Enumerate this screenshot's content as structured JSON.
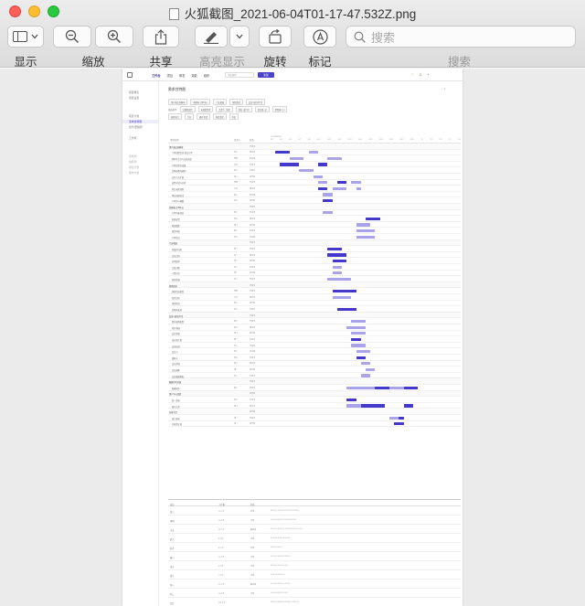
{
  "window": {
    "title": "火狐截图_2021-06-04T01-17-47.532Z.png"
  },
  "toolbar": {
    "display_label": "显示",
    "zoom_label": "缩放",
    "share_label": "共享",
    "highlight_label": "高亮显示",
    "rotate_label": "旋转",
    "markup_label": "标记",
    "search_placeholder": "搜索",
    "search_label": "搜索"
  },
  "colors": {
    "bar_primary": "#4338c9",
    "bar_light": "#a9a3ea",
    "close": "#fe5f57",
    "minimize": "#febc2e",
    "zoom": "#28c840"
  },
  "app": {
    "nav": [
      {
        "label": "工作台",
        "active": true
      },
      {
        "label": "项目",
        "active": false
      },
      {
        "label": "研发",
        "active": false
      },
      {
        "label": "效能",
        "active": false
      },
      {
        "label": "组织",
        "active": false
      }
    ],
    "search_text": "全局搜索",
    "new_button": "新建",
    "sidebar": [
      {
        "label": "项目概览",
        "state": "normal"
      },
      {
        "label": "项目设置",
        "state": "normal"
      },
      {
        "label": "项目计划",
        "state": "normal"
      },
      {
        "label": "需求甘特图",
        "state": "selected"
      },
      {
        "label": "迭代/里程碑",
        "state": "normal"
      },
      {
        "label": "工作项",
        "state": "normal"
      },
      {
        "label": "需求池",
        "state": "gray"
      },
      {
        "label": "缺陷池",
        "state": "gray"
      },
      {
        "label": "测试计划",
        "state": "gray"
      },
      {
        "label": "发布计划",
        "state": "gray"
      }
    ],
    "page_title": "需求甘特图",
    "filters_line1": [
      "用户端交易模块",
      "商家端-订单中心",
      "门店收银",
      "营销活动",
      "会员与积分平台"
    ],
    "filters_line2_label": "筛选条件",
    "filters_line2": [
      "已规划迭代",
      "未规划需求",
      "负责人: 全部",
      "状态: 进行中",
      "优先级: 高",
      "里程碑: Q3"
    ],
    "filters_line3": [
      "按周显示",
      "今日",
      "展开全部",
      "收起全部",
      "导出"
    ],
    "columns": {
      "name": "需求名称",
      "owner": "负责人",
      "status": "状态"
    },
    "month_label": "2021年06月",
    "date_ticks": [
      "6/1",
      "6/3",
      "6/5",
      "6/7",
      "6/9",
      "6/11",
      "6/13",
      "6/15",
      "6/17",
      "6/19",
      "6/21",
      "6/23",
      "6/25",
      "6/27",
      "6/29",
      "7/1",
      "7/3",
      "7/5",
      "7/7",
      "7/9"
    ]
  },
  "gantt": {
    "timeline_days": 40,
    "rows": [
      {
        "name": "用户端交易模块",
        "owner": "",
        "status": "开发中",
        "group": true,
        "bars": []
      },
      {
        "name": "下单流程优化-提交订单",
        "owner": "张三",
        "status": "测试中",
        "group": false,
        "bars": [
          [
            1,
            3,
            "p"
          ],
          [
            8,
            2,
            "l"
          ]
        ]
      },
      {
        "name": "购物车合并与失效商品",
        "owner": "李四",
        "status": "已完成",
        "group": false,
        "bars": [
          [
            4,
            3,
            "l"
          ],
          [
            12,
            3,
            "l"
          ]
        ]
      },
      {
        "name": "订单详情页改版",
        "owner": "王五",
        "status": "开发中",
        "group": false,
        "bars": [
          [
            2,
            4,
            "p"
          ],
          [
            10,
            2,
            "p"
          ]
        ]
      },
      {
        "name": "优惠券叠加规则",
        "owner": "赵六",
        "status": "开发中",
        "group": false,
        "bars": [
          [
            6,
            3,
            "l"
          ]
        ]
      },
      {
        "name": "支付方式扩展",
        "owner": "张三",
        "status": "待开发",
        "group": false,
        "bars": [
          [
            9,
            2,
            "l"
          ]
        ]
      },
      {
        "name": "发票申请与开具",
        "owner": "李四",
        "status": "开发中",
        "group": false,
        "bars": [
          [
            10,
            2,
            "l"
          ],
          [
            14,
            2,
            "p"
          ],
          [
            17,
            2,
            "l"
          ]
        ]
      },
      {
        "name": "售后退款流程",
        "owner": "王五",
        "status": "测试中",
        "group": false,
        "bars": [
          [
            10,
            2,
            "p"
          ],
          [
            13,
            3,
            "l"
          ],
          [
            18,
            1,
            "l"
          ]
        ]
      },
      {
        "name": "地址管理优化",
        "owner": "赵六",
        "status": "已完成",
        "group": false,
        "bars": [
          [
            11,
            2,
            "l"
          ]
        ]
      },
      {
        "name": "订单评价晒图",
        "owner": "孙七",
        "status": "待开发",
        "group": false,
        "bars": [
          [
            11,
            2,
            "p"
          ]
        ]
      },
      {
        "name": "商家端-订单中心",
        "owner": "",
        "status": "开发中",
        "group": true,
        "bars": []
      },
      {
        "name": "订单列表筛选",
        "owner": "周八",
        "status": "开发中",
        "group": false,
        "bars": [
          [
            11,
            2,
            "l"
          ]
        ]
      },
      {
        "name": "批量发货",
        "owner": "吴九",
        "status": "测试中",
        "group": false,
        "bars": [
          [
            20,
            3,
            "p"
          ]
        ]
      },
      {
        "name": "物流跟踪",
        "owner": "郑十",
        "status": "待开发",
        "group": false,
        "bars": [
          [
            18,
            3,
            "l"
          ]
        ]
      },
      {
        "name": "退货审核",
        "owner": "周八",
        "status": "开发中",
        "group": false,
        "bars": [
          [
            18,
            4,
            "l"
          ]
        ]
      },
      {
        "name": "订单导出",
        "owner": "吴九",
        "status": "已完成",
        "group": false,
        "bars": [
          [
            18,
            4,
            "l"
          ]
        ]
      },
      {
        "name": "门店收银",
        "owner": "",
        "status": "开发中",
        "group": true,
        "bars": []
      },
      {
        "name": "收银台扫码",
        "owner": "钱一",
        "status": "开发中",
        "group": false,
        "bars": [
          [
            12,
            3,
            "p"
          ]
        ]
      },
      {
        "name": "会员识别",
        "owner": "孙二",
        "status": "测试中",
        "group": false,
        "bars": [
          [
            12,
            4,
            "p"
          ]
        ]
      },
      {
        "name": "挂单取单",
        "owner": "钱一",
        "status": "待开发",
        "group": false,
        "bars": [
          [
            13,
            3,
            "p"
          ]
        ]
      },
      {
        "name": "交班对账",
        "owner": "孙二",
        "status": "开发中",
        "group": false,
        "bars": [
          [
            13,
            2,
            "l"
          ]
        ]
      },
      {
        "name": "小票打印",
        "owner": "钱一",
        "status": "已完成",
        "group": false,
        "bars": [
          [
            13,
            2,
            "l"
          ]
        ]
      },
      {
        "name": "离线收银",
        "owner": "孙二",
        "status": "开发中",
        "group": false,
        "bars": [
          [
            12,
            5,
            "l"
          ]
        ]
      },
      {
        "name": "营销活动",
        "owner": "",
        "status": "开发中",
        "group": true,
        "bars": []
      },
      {
        "name": "满减活动配置",
        "owner": "李四",
        "status": "开发中",
        "group": false,
        "bars": [
          [
            13,
            5,
            "p"
          ]
        ]
      },
      {
        "name": "秒杀活动",
        "owner": "王五",
        "status": "测试中",
        "group": false,
        "bars": [
          [
            13,
            4,
            "l"
          ]
        ]
      },
      {
        "name": "拼团活动",
        "owner": "赵六",
        "status": "待开发",
        "group": false,
        "bars": []
      },
      {
        "name": "优惠券发放",
        "owner": "孙七",
        "status": "开发中",
        "group": false,
        "bars": [
          [
            14,
            4,
            "p"
          ]
        ]
      },
      {
        "name": "会员与积分平台",
        "owner": "",
        "status": "开发中",
        "group": true,
        "bars": []
      },
      {
        "name": "积分规则配置",
        "owner": "周八",
        "status": "开发中",
        "group": false,
        "bars": [
          [
            17,
            3,
            "l"
          ]
        ]
      },
      {
        "name": "积分商城",
        "owner": "吴九",
        "status": "测试中",
        "group": false,
        "bars": [
          [
            16,
            4,
            "l"
          ]
        ]
      },
      {
        "name": "会员等级",
        "owner": "郑十",
        "status": "待开发",
        "group": false,
        "bars": [
          [
            17,
            3,
            "l"
          ]
        ]
      },
      {
        "name": "成长值计算",
        "owner": "钱一",
        "status": "开发中",
        "group": false,
        "bars": [
          [
            17,
            2,
            "p"
          ]
        ]
      },
      {
        "name": "会员权益",
        "owner": "孙二",
        "status": "开发中",
        "group": false,
        "bars": [
          [
            17,
            3,
            "l"
          ]
        ]
      },
      {
        "name": "会员卡",
        "owner": "周八",
        "status": "已完成",
        "group": false,
        "bars": [
          [
            18,
            3,
            "l"
          ]
        ]
      },
      {
        "name": "储值卡",
        "owner": "吴九",
        "status": "开发中",
        "group": false,
        "bars": [
          [
            18,
            2,
            "p"
          ]
        ]
      },
      {
        "name": "会员营销",
        "owner": "郑十",
        "status": "测试中",
        "group": false,
        "bars": [
          [
            19,
            2,
            "l"
          ]
        ]
      },
      {
        "name": "会员画像",
        "owner": "钱一",
        "status": "待开发",
        "group": false,
        "bars": [
          [
            20,
            2,
            "l"
          ]
        ]
      },
      {
        "name": "会员数据看板",
        "owner": "孙二",
        "status": "开发中",
        "group": false,
        "bars": [
          [
            19,
            2,
            "l"
          ]
        ]
      },
      {
        "name": "数据中台对接",
        "owner": "",
        "status": "开发中",
        "group": true,
        "bars": []
      },
      {
        "name": "数据同步",
        "owner": "周八",
        "status": "开发中",
        "group": false,
        "bars": [
          [
            16,
            15,
            "l"
          ],
          [
            22,
            3,
            "p"
          ],
          [
            28,
            3,
            "p"
          ]
        ]
      },
      {
        "name": "用户中心改造",
        "owner": "",
        "status": "待开发",
        "group": true,
        "bars": []
      },
      {
        "name": "统一登录",
        "owner": "吴九",
        "status": "开发中",
        "group": false,
        "bars": [
          [
            16,
            2,
            "p"
          ]
        ]
      },
      {
        "name": "账号合并",
        "owner": "郑十",
        "status": "测试中",
        "group": false,
        "bars": [
          [
            16,
            6,
            "l"
          ],
          [
            19,
            5,
            "p"
          ],
          [
            28,
            2,
            "p"
          ]
        ]
      },
      {
        "name": "开放平台",
        "owner": "",
        "status": "待开发",
        "group": true,
        "bars": []
      },
      {
        "name": "接口鉴权",
        "owner": "钱一",
        "status": "开发中",
        "group": false,
        "bars": [
          [
            25,
            2,
            "l"
          ],
          [
            27,
            1,
            "p"
          ]
        ]
      },
      {
        "name": "开发者文档",
        "owner": "孙二",
        "status": "待开发",
        "group": false,
        "bars": [
          [
            26,
            2,
            "p"
          ]
        ]
      }
    ]
  },
  "summary": {
    "columns": [
      "成员",
      "工作量",
      "状态"
    ],
    "rows": [
      {
        "name": "张三",
        "a": "12人天",
        "b": "正常",
        "nums": "0.5 0.5 1.0 1.0 0.5 0.5 1.0 1.0 0.5 0.5"
      },
      {
        "name": "李四",
        "a": "10人天",
        "b": "正常",
        "nums": "1.0 1.0 0.5 0.5 1.0 1.0 0.5 0.5 1.0"
      },
      {
        "name": "王五",
        "a": "15人天",
        "b": "超负荷",
        "nums": "1.5 1.5 1.0 1.0 1.5 1.5 1.0 1.0 1.5 1.5 1.0"
      },
      {
        "name": "赵六",
        "a": "8人天",
        "b": "正常",
        "nums": "0.5 0.5 0.5 0.5 1.0 1.0 0.5"
      },
      {
        "name": "孙七",
        "a": "6人天",
        "b": "空闲",
        "nums": "0.5 0.5 0.5 0.5"
      },
      {
        "name": "周八",
        "a": "11人天",
        "b": "正常",
        "nums": "1.0 1.0 1.0 0.5 0.5 1.0 1.0"
      },
      {
        "name": "吴九",
        "a": "9人天",
        "b": "正常",
        "nums": "0.5 1.0 1.0 0.5 0.5 1.0"
      },
      {
        "name": "郑十",
        "a": "7人天",
        "b": "正常",
        "nums": "1.0 0.5 0.5 0.5 1.0"
      },
      {
        "name": "钱一",
        "a": "13人天",
        "b": "超负荷",
        "nums": "1.5 1.0 1.0 1.5 1.5 1.0 1.0"
      },
      {
        "name": "孙二",
        "a": "10人天",
        "b": "正常",
        "nums": "1.0 1.0 0.5 0.5 1.0 1.0"
      },
      {
        "name": "合计",
        "a": "101人天",
        "b": "",
        "nums": "9.0 9.5 8.5 8.0 9.0 9.5 8.0 7.5 6.0 5.5"
      }
    ]
  }
}
